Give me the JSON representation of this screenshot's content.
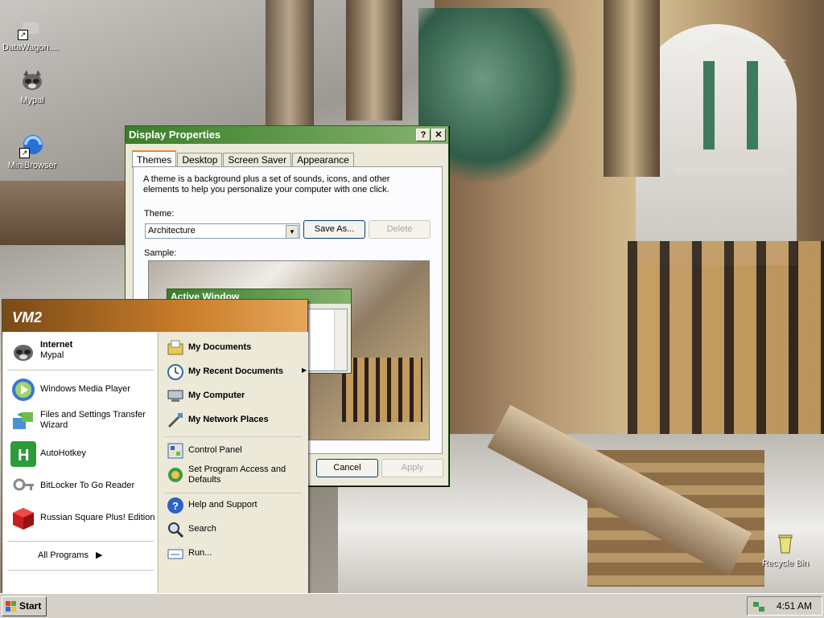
{
  "desktop": {
    "icons": [
      {
        "label": "DataWagon...."
      },
      {
        "label": "Mypal"
      },
      {
        "label": "MiniBrowser"
      },
      {
        "label": "Recycle Bin"
      }
    ]
  },
  "display_properties": {
    "title": "Display Properties",
    "help_glyph": "?",
    "close_glyph": "✕",
    "tabs": [
      "Themes",
      "Desktop",
      "Screen Saver",
      "Appearance"
    ],
    "description": "A theme is a background plus a set of sounds, icons, and other elements to help you personalize your computer with one click.",
    "theme_label": "Theme:",
    "theme_value": "Architecture",
    "save_as": "Save As...",
    "delete": "Delete",
    "sample_label": "Sample:",
    "sample_window_title": "Active Window",
    "cancel": "Cancel",
    "apply": "Apply"
  },
  "start_menu": {
    "user": "VM2",
    "pinned": [
      {
        "title": "Internet",
        "subtitle": "Mypal"
      }
    ],
    "recent": [
      {
        "title": "Windows Media Player"
      },
      {
        "title": "Files and Settings Transfer Wizard"
      },
      {
        "title": "AutoHotkey"
      },
      {
        "title": "BitLocker To Go Reader"
      },
      {
        "title": "Russian Square Plus! Edition"
      }
    ],
    "all_programs": "All Programs",
    "right": [
      {
        "title": "My Documents"
      },
      {
        "title": "My Recent Documents"
      },
      {
        "title": "My Computer"
      },
      {
        "title": "My Network Places"
      },
      {
        "title": "Control Panel"
      },
      {
        "title": "Set Program Access and Defaults"
      },
      {
        "title": "Help and Support"
      },
      {
        "title": "Search"
      },
      {
        "title": "Run..."
      }
    ]
  },
  "taskbar": {
    "start_label": "Start",
    "clock": "4:51 AM"
  },
  "colors": {
    "title_green": "#3a7e2a",
    "start_header": "#c97d2a",
    "tab_highlight": "#e68b2c"
  }
}
